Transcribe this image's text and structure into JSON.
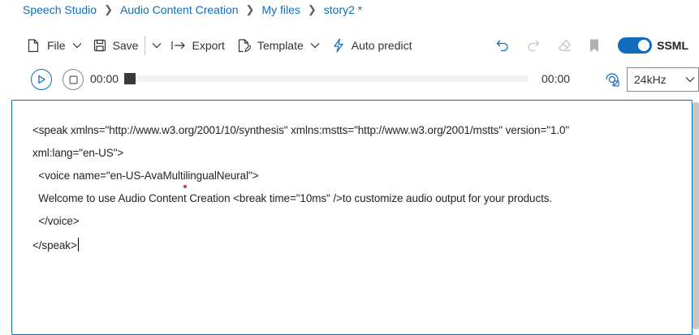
{
  "breadcrumb": {
    "items": [
      "Speech Studio",
      "Audio Content Creation",
      "My files",
      "story2 *"
    ]
  },
  "toolbar": {
    "file_label": "File",
    "save_label": "Save",
    "export_label": "Export",
    "template_label": "Template",
    "auto_predict_label": "Auto predict",
    "ssml_label": "SSML",
    "ssml_enabled": true
  },
  "player": {
    "current_time": "00:00",
    "total_time": "00:00",
    "progress": 0,
    "sample_rate": "24kHz"
  },
  "editor": {
    "lines": [
      "<speak xmlns=\"http://www.w3.org/2001/10/synthesis\" xmlns:mstts=\"http://www.w3.org/2001/mstts\" version=\"1.0\"",
      "xml:lang=\"en-US\">",
      "  <voice name=\"en-US-AvaMultilingualNeural\">",
      "  Welcome to use Audio Content Creation <break time=\"10ms\" />to customize audio output for your products.",
      "  </voice>",
      "</speak>"
    ]
  },
  "colors": {
    "accent": "#0f6cbd",
    "text": "#323130",
    "disabled": "#c8c6c4"
  },
  "icons": {
    "file": "document-icon",
    "save": "floppy-disk-icon",
    "export": "arrow-export-icon",
    "template": "document-edit-icon",
    "auto_predict": "lightning-icon",
    "undo": "undo-icon",
    "redo": "redo-icon",
    "eraser": "eraser-icon",
    "bookmark": "bookmark-icon",
    "play": "play-icon",
    "stop": "stop-icon",
    "sample_rate": "audio-settings-icon"
  }
}
